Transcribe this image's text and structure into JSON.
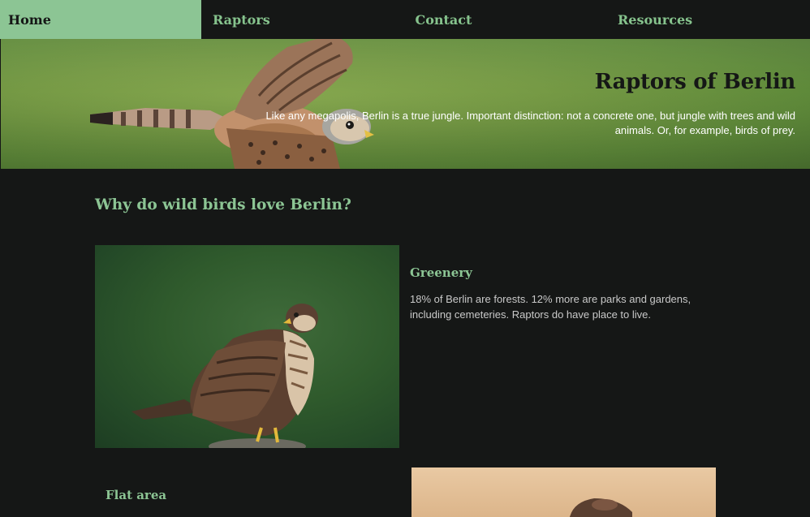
{
  "nav": {
    "items": [
      {
        "label": "Home",
        "active": true
      },
      {
        "label": "Raptors",
        "active": false
      },
      {
        "label": "Contact",
        "active": false
      },
      {
        "label": "Resources",
        "active": false
      }
    ]
  },
  "hero": {
    "title": "Raptors of Berlin",
    "subtitle": "Like any megapolis, Berlin is a true jungle. Important distinction: not a concrete one, but jungle with trees and wild animals. Or, for example, birds of prey."
  },
  "main": {
    "section_title": "Why do wild birds love Berlin?",
    "features": [
      {
        "heading": "Greenery",
        "text": "18% of Berlin are forests. 12% more are parks and gardens, including cemeteries. Raptors do have place to live."
      },
      {
        "heading": "Flat area",
        "text": ""
      }
    ]
  },
  "colors": {
    "background": "#151716",
    "accent": "#8cc594",
    "hero_green": "#769a45",
    "text": "#c9c9c9"
  }
}
